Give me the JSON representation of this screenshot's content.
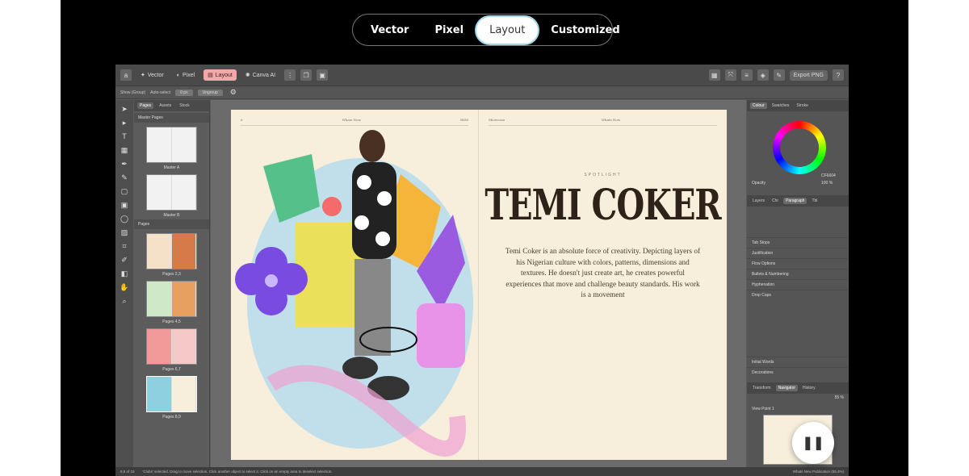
{
  "mode_switcher": {
    "items": [
      {
        "label": "Vector"
      },
      {
        "label": "Pixel"
      },
      {
        "label": "Layout",
        "active": true
      },
      {
        "label": "Customized"
      }
    ]
  },
  "toolbar": {
    "personas": [
      {
        "label": "Vector",
        "icon": "vector-icon"
      },
      {
        "label": "Pixel",
        "icon": "pixel-icon"
      },
      {
        "label": "Layout",
        "icon": "layout-icon",
        "active": true
      },
      {
        "label": "Canva AI",
        "icon": "canva-ai-icon"
      }
    ],
    "export_label": "Export PNG"
  },
  "context_bar": {
    "selection": "Show (Group)",
    "auto_select": "Auto-select",
    "stroke_value": "0 px",
    "ungroup": "Ungroup"
  },
  "pages_panel": {
    "tabs": [
      "Pages",
      "Assets",
      "Stock"
    ],
    "master_header": "Master Pages",
    "masters": [
      "Master A",
      "Master B"
    ],
    "pages_header": "Pages",
    "pages": [
      "Pages 2,3",
      "Pages 4,5",
      "Pages 6,7",
      "Pages 8,9"
    ]
  },
  "spread": {
    "runhead_left": [
      "6",
      "Whats Now",
      "RSM"
    ],
    "runhead_right": [
      "Showcase",
      "Whats Now",
      ""
    ],
    "spotlight": "SPOTLIGHT",
    "title": "TEMI COKER",
    "lead": "Temi Coker is an absolute force of creativity. Depicting layers of his Nigerian culture with colors, patterns, dimensions and textures. He doesn't just create art, he creates powerful experiences that move and challenge beauty standards. His work is a movement"
  },
  "right_panel": {
    "tabs": [
      "Colour",
      "Swatches",
      "Stroke"
    ],
    "opacity_label": "Opacity",
    "opacity_value": "100 %",
    "hex": "CF6604",
    "para_tabs": [
      "Layers",
      "Chr",
      "Paragraph",
      "Tbl"
    ],
    "sections": [
      "Tab Stops",
      "Justification",
      "Flow Options",
      "Bullets & Numbering",
      "Hyphenation",
      "Drop Caps",
      "Initial Words",
      "Decorations"
    ],
    "nav_tabs": [
      "Transform",
      "Navigator",
      "History"
    ],
    "zoom": "55 %",
    "view_label": "View Point 1",
    "footer": "Whats New Publication (55.4%)"
  },
  "status_bar": {
    "page_indicator": "8,9 of 15",
    "hint": "'Clubs' selected. Drag to move selection. Click another object to select it. Click on an empty area to deselect selection."
  }
}
